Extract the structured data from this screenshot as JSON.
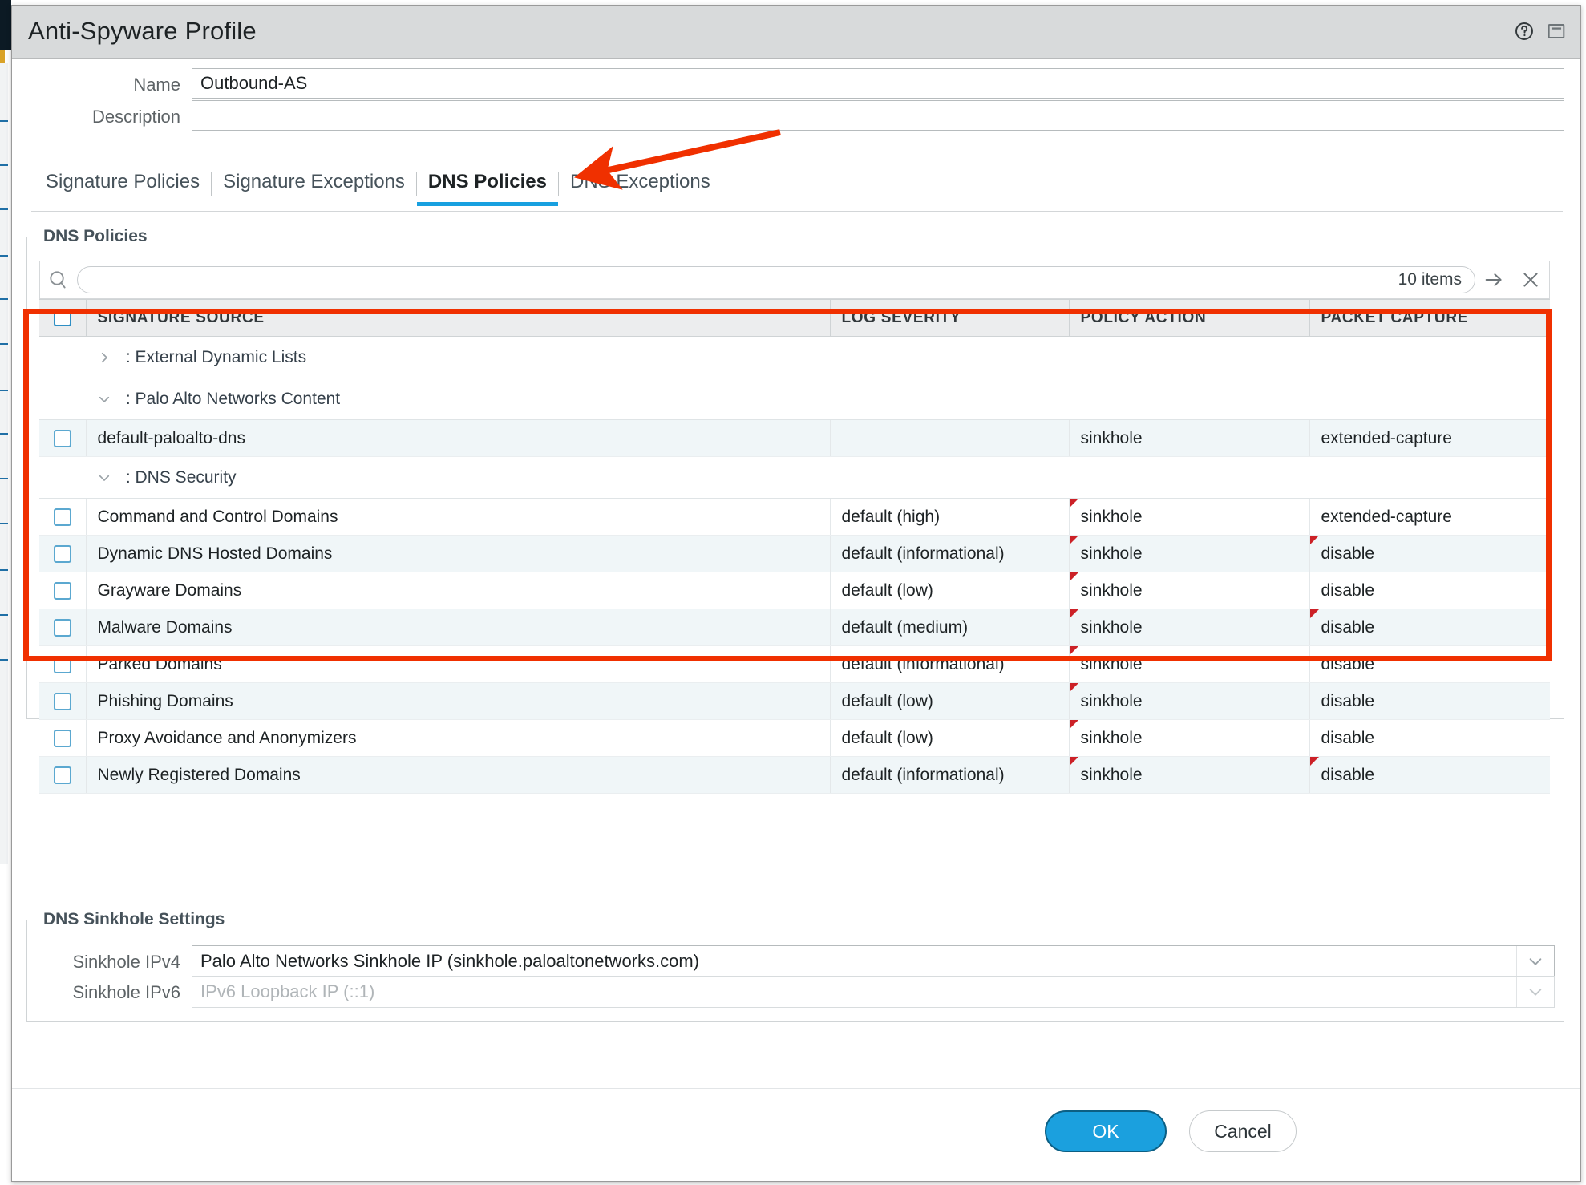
{
  "window": {
    "title": "Anti-Spyware Profile",
    "help_icon": "help-circle-icon",
    "restore_icon": "window-restore-icon"
  },
  "form": {
    "name_label": "Name",
    "name_value": "Outbound-AS",
    "description_label": "Description",
    "description_value": "",
    "description_placeholder": ""
  },
  "tabs": [
    {
      "label": "Signature Policies",
      "active": false
    },
    {
      "label": "Signature Exceptions",
      "active": false
    },
    {
      "label": "DNS Policies",
      "active": true
    },
    {
      "label": "DNS Exceptions",
      "active": false
    }
  ],
  "dns_policies": {
    "legend": "DNS Policies",
    "search": {
      "icon": "search-icon",
      "value": "",
      "placeholder": "",
      "count_label": "10 items",
      "submit_icon": "arrow-right-icon",
      "clear_icon": "close-x-icon"
    },
    "columns": [
      "SIGNATURE SOURCE",
      "LOG SEVERITY",
      "POLICY ACTION",
      "PACKET CAPTURE"
    ],
    "rows": [
      {
        "type": "group",
        "caret": "chevron-right-icon",
        "label": ": External Dynamic Lists"
      },
      {
        "type": "group",
        "caret": "chevron-down-icon",
        "label": ": Palo Alto Networks Content"
      },
      {
        "type": "item",
        "checked": false,
        "name": "default-paloalto-dns",
        "severity": "",
        "action": "sinkhole",
        "capture": "extended-capture",
        "action_modified": false,
        "capture_modified": false,
        "stripe": "alt"
      },
      {
        "type": "group",
        "caret": "chevron-down-icon",
        "label": ": DNS Security"
      },
      {
        "type": "item",
        "checked": false,
        "name": "Command and Control Domains",
        "severity": "default (high)",
        "action": "sinkhole",
        "capture": "extended-capture",
        "action_modified": true,
        "capture_modified": false,
        "stripe": "plain"
      },
      {
        "type": "item",
        "checked": false,
        "name": "Dynamic DNS Hosted Domains",
        "severity": "default (informational)",
        "action": "sinkhole",
        "capture": "disable",
        "action_modified": true,
        "capture_modified": true,
        "stripe": "alt"
      },
      {
        "type": "item",
        "checked": false,
        "name": "Grayware Domains",
        "severity": "default (low)",
        "action": "sinkhole",
        "capture": "disable",
        "action_modified": true,
        "capture_modified": false,
        "stripe": "plain"
      },
      {
        "type": "item",
        "checked": false,
        "name": "Malware Domains",
        "severity": "default (medium)",
        "action": "sinkhole",
        "capture": "disable",
        "action_modified": true,
        "capture_modified": true,
        "stripe": "alt"
      },
      {
        "type": "item",
        "checked": false,
        "name": "Parked Domains",
        "severity": "default (informational)",
        "action": "sinkhole",
        "capture": "disable",
        "action_modified": true,
        "capture_modified": false,
        "stripe": "plain"
      },
      {
        "type": "item",
        "checked": false,
        "name": "Phishing Domains",
        "severity": "default (low)",
        "action": "sinkhole",
        "capture": "disable",
        "action_modified": true,
        "capture_modified": false,
        "stripe": "alt"
      },
      {
        "type": "item",
        "checked": false,
        "name": "Proxy Avoidance and Anonymizers",
        "severity": "default (low)",
        "action": "sinkhole",
        "capture": "disable",
        "action_modified": true,
        "capture_modified": false,
        "stripe": "plain"
      },
      {
        "type": "item",
        "checked": false,
        "name": "Newly Registered Domains",
        "severity": "default (informational)",
        "action": "sinkhole",
        "capture": "disable",
        "action_modified": true,
        "capture_modified": true,
        "stripe": "alt"
      }
    ]
  },
  "sinkhole": {
    "legend": "DNS Sinkhole Settings",
    "ipv4_label": "Sinkhole IPv4",
    "ipv4_value": "Palo Alto Networks Sinkhole IP (sinkhole.paloaltonetworks.com)",
    "ipv6_label": "Sinkhole IPv6",
    "ipv6_value": "",
    "ipv6_placeholder": "IPv6 Loopback IP (::1)",
    "chevron_icon": "chevron-down-icon"
  },
  "footer": {
    "ok_label": "OK",
    "cancel_label": "Cancel"
  },
  "annotations": {
    "highlight_color": "#f03000",
    "arrow_color": "#f03000"
  }
}
